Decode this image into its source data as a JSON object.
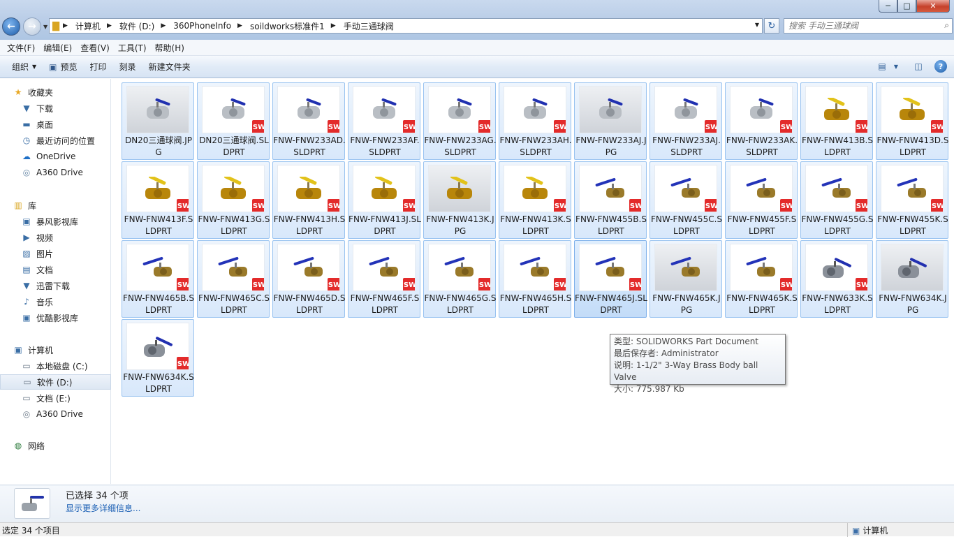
{
  "window": {
    "controls": {
      "min": "─",
      "max": "□",
      "close": "✕"
    }
  },
  "address": {
    "crumbs": [
      "计算机",
      "软件 (D:)",
      "360PhoneInfo",
      "soildworks标准件1",
      "手动三通球阀"
    ]
  },
  "search": {
    "placeholder": "搜索 手动三通球阀"
  },
  "menu": [
    "文件(F)",
    "编辑(E)",
    "查看(V)",
    "工具(T)",
    "帮助(H)"
  ],
  "toolbar": {
    "organize": "组织",
    "preview": "预览",
    "print": "打印",
    "burn": "刻录",
    "new_folder": "新建文件夹"
  },
  "sidebar": {
    "favorites": {
      "title": "收藏夹",
      "items": [
        "下载",
        "桌面",
        "最近访问的位置",
        "OneDrive",
        "A360 Drive"
      ]
    },
    "libraries": {
      "title": "库",
      "items": [
        "暴风影视库",
        "视频",
        "图片",
        "文档",
        "迅雷下载",
        "音乐",
        "优酷影视库"
      ]
    },
    "computer": {
      "title": "计算机",
      "items": [
        "本地磁盘 (C:)",
        "软件 (D:)",
        "文档 (E:)",
        "A360 Drive"
      ]
    },
    "network": {
      "title": "网络"
    }
  },
  "files": [
    {
      "name": "DN20三通球阀.JPG",
      "kind": "jpg",
      "color": "steel"
    },
    {
      "name": "DN20三通球阀.SLDPRT",
      "kind": "sldprt",
      "color": "steel"
    },
    {
      "name": "FNW-FNW233AD.SLDPRT",
      "kind": "sldprt",
      "color": "steel"
    },
    {
      "name": "FNW-FNW233AF.SLDPRT",
      "kind": "sldprt",
      "color": "steel"
    },
    {
      "name": "FNW-FNW233AG.SLDPRT",
      "kind": "sldprt",
      "color": "steel"
    },
    {
      "name": "FNW-FNW233AH.SLDPRT",
      "kind": "sldprt",
      "color": "steel"
    },
    {
      "name": "FNW-FNW233AJ.JPG",
      "kind": "jpg",
      "color": "steel"
    },
    {
      "name": "FNW-FNW233AJ.SLDPRT",
      "kind": "sldprt",
      "color": "steel"
    },
    {
      "name": "FNW-FNW233AK.SLDPRT",
      "kind": "sldprt",
      "color": "steel"
    },
    {
      "name": "FNW-FNW413B.SLDPRT",
      "kind": "sldprt",
      "color": "brass-yellow"
    },
    {
      "name": "FNW-FNW413D.SLDPRT",
      "kind": "sldprt",
      "color": "brass-yellow"
    },
    {
      "name": "FNW-FNW413F.SLDPRT",
      "kind": "sldprt",
      "color": "brass-yellow"
    },
    {
      "name": "FNW-FNW413G.SLDPRT",
      "kind": "sldprt",
      "color": "brass-yellow"
    },
    {
      "name": "FNW-FNW413H.SLDPRT",
      "kind": "sldprt",
      "color": "brass-yellow"
    },
    {
      "name": "FNW-FNW413J.SLDPRT",
      "kind": "sldprt",
      "color": "brass-yellow"
    },
    {
      "name": "FNW-FNW413K.JPG",
      "kind": "jpg",
      "color": "brass-yellow"
    },
    {
      "name": "FNW-FNW413K.SLDPRT",
      "kind": "sldprt",
      "color": "brass-yellow"
    },
    {
      "name": "FNW-FNW455B.SLDPRT",
      "kind": "sldprt",
      "color": "brass-blue"
    },
    {
      "name": "FNW-FNW455C.SLDPRT",
      "kind": "sldprt",
      "color": "brass-blue"
    },
    {
      "name": "FNW-FNW455F.SLDPRT",
      "kind": "sldprt",
      "color": "brass-blue"
    },
    {
      "name": "FNW-FNW455G.SLDPRT",
      "kind": "sldprt",
      "color": "brass-blue"
    },
    {
      "name": "FNW-FNW455K.SLDPRT",
      "kind": "sldprt",
      "color": "brass-blue"
    },
    {
      "name": "FNW-FNW465B.SLDPRT",
      "kind": "sldprt",
      "color": "brass-blue"
    },
    {
      "name": "FNW-FNW465C.SLDPRT",
      "kind": "sldprt",
      "color": "brass-blue"
    },
    {
      "name": "FNW-FNW465D.SLDPRT",
      "kind": "sldprt",
      "color": "brass-blue"
    },
    {
      "name": "FNW-FNW465F.SLDPRT",
      "kind": "sldprt",
      "color": "brass-blue"
    },
    {
      "name": "FNW-FNW465G.SLDPRT",
      "kind": "sldprt",
      "color": "brass-blue"
    },
    {
      "name": "FNW-FNW465H.SLDPRT",
      "kind": "sldprt",
      "color": "brass-blue"
    },
    {
      "name": "FNW-FNW465J.SLDPRT",
      "kind": "sldprt",
      "color": "brass-blue"
    },
    {
      "name": "FNW-FNW465K.JPG",
      "kind": "jpg",
      "color": "brass-blue"
    },
    {
      "name": "FNW-FNW465K.SLDPRT",
      "kind": "sldprt",
      "color": "brass-blue"
    },
    {
      "name": "FNW-FNW633K.SLDPRT",
      "kind": "sldprt",
      "color": "steel-blue"
    },
    {
      "name": "FNW-FNW634K.JPG",
      "kind": "jpg",
      "color": "steel-blue"
    },
    {
      "name": "FNW-FNW634K.SLDPRT",
      "kind": "sldprt",
      "color": "steel-blue"
    }
  ],
  "tooltip": {
    "type": "类型: SOLIDWORKS Part Document",
    "saved_by": "最后保存者: Administrator",
    "desc": "说明: 1-1/2\" 3-Way Brass Body ball Valve",
    "size": "大小: 775.987 Kb"
  },
  "details": {
    "selected": "已选择 34 个项",
    "more": "显示更多详细信息..."
  },
  "status": {
    "left": "选定 34 个项目",
    "right": "计算机"
  },
  "badge_text": "SW",
  "colors": {
    "selection_bg": "#d8e8fb",
    "selection_border": "#99c3f0",
    "accent": "#1a5fb4",
    "badge": "#e32b2b"
  }
}
